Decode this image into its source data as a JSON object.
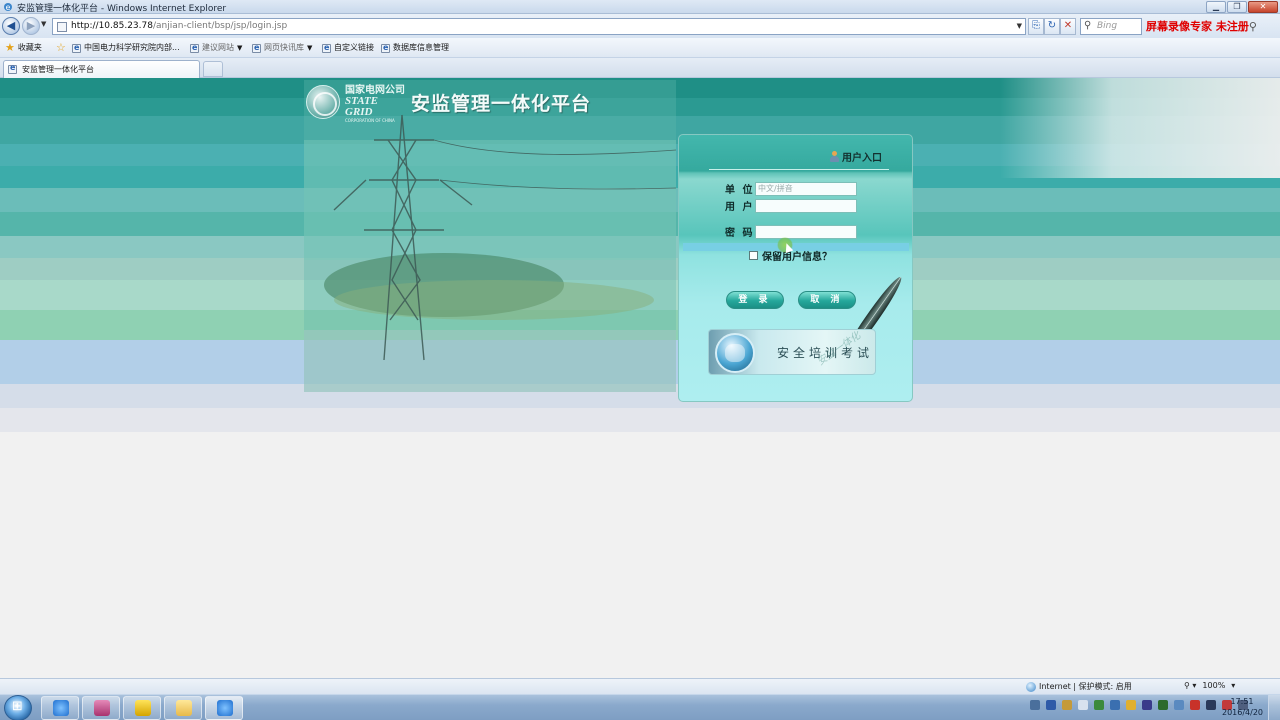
{
  "window": {
    "title": "安监管理一体化平台 - Windows Internet Explorer",
    "buttons": [
      "▁",
      "❐",
      "✕"
    ]
  },
  "address_bar": {
    "url_host": "http://10.85.23.78",
    "url_path": "/anjian-client/bsp/jsp/login.jsp",
    "search_placeholder": "Bing",
    "watermark_text": "屏幕录像专家  未注册"
  },
  "favorites_bar": {
    "favorites_label": "收藏夹",
    "items": [
      {
        "label": "中国电力科学研究院内部..."
      },
      {
        "label": "建议网站",
        "dropdown": true
      },
      {
        "label": "网页快讯库",
        "dropdown": true
      },
      {
        "label": "自定义链接"
      },
      {
        "label": "数据库信息管理"
      }
    ]
  },
  "tabs": [
    {
      "label": "安监管理一体化平台",
      "active": true
    }
  ],
  "page": {
    "brand_cn": "国家电网公司",
    "brand_en": "STATE GRID",
    "brand_en_sub": "CORPORATION OF CHINA",
    "platform_title": "安监管理一体化平台",
    "login": {
      "header": "用户入口",
      "unit_label": "单 位",
      "unit_placeholder": "中文/拼音",
      "user_label": "用 户",
      "password_label": "密 码",
      "remember_label": "保留用户信息？",
      "login_button": "登 录",
      "cancel_button": "取 消",
      "exam_banner": "安全培训考试",
      "exam_watermark": "安监一体化"
    }
  },
  "status_bar": {
    "zone": "Internet | 保护模式: 启用",
    "zoom": "100%"
  },
  "taskbar": {
    "time": "17:51",
    "date": "2016/4/20"
  },
  "colors": {
    "teal_dark": "#1b8e85",
    "teal_mid": "#44b3a9",
    "teal_light": "#8fd6cd",
    "sky_blue": "#9fc3de",
    "accent_red": "#e00000"
  }
}
